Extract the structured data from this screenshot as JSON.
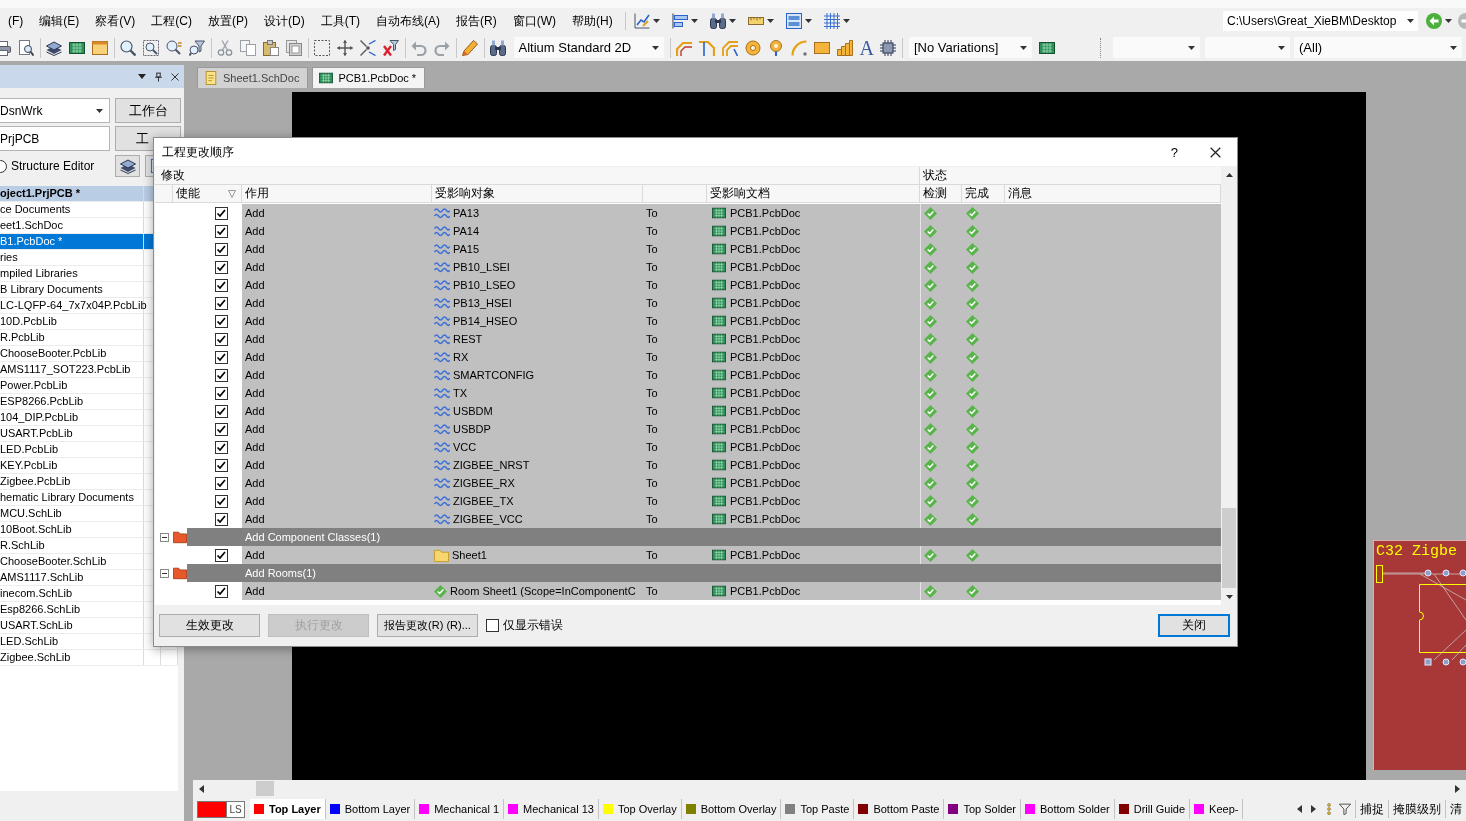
{
  "menu_bar": {
    "items": [
      "(F)",
      "编辑(E)",
      "察看(V)",
      "工程(C)",
      "放置(P)",
      "设计(D)",
      "工具(T)",
      "自动布线(A)",
      "报告(R)",
      "窗口(W)",
      "帮助(H)"
    ],
    "path": "C:\\Users\\Great_XieBM\\Desktop"
  },
  "toolbar": {
    "view_config": "Altium Standard 2D",
    "string_tool": "A",
    "variations": "[No Variations]",
    "scope": "(All)"
  },
  "projects_panel": {
    "workspace": "DsnWrk",
    "workspace_button": "工作台",
    "project": "PrjPCB",
    "project_button": "工",
    "structure_editor": {
      "label": "Structure Editor",
      "selected": false
    },
    "project_item": "oject1.PrjPCB *",
    "items": [
      {
        "label": "ce Documents",
        "selected": false
      },
      {
        "label": "eet1.SchDoc",
        "selected": false
      },
      {
        "label": "B1.PcbDoc *",
        "selected": true
      },
      {
        "label": "ries",
        "selected": false
      },
      {
        "label": "mpiled Libraries",
        "selected": false
      },
      {
        "label": "B Library Documents",
        "selected": false
      },
      {
        "label": "LC-LQFP-64_7x7x04P.PcbLib",
        "selected": false
      },
      {
        "label": "10D.PcbLib",
        "selected": false
      },
      {
        "label": "R.PcbLib",
        "selected": false
      },
      {
        "label": "ChooseBooter.PcbLib",
        "selected": false
      },
      {
        "label": "AMS1117_SOT223.PcbLib",
        "selected": false
      },
      {
        "label": "Power.PcbLib",
        "selected": false
      },
      {
        "label": "ESP8266.PcbLib",
        "selected": false
      },
      {
        "label": "104_DIP.PcbLib",
        "selected": false
      },
      {
        "label": "USART.PcbLib",
        "selected": false
      },
      {
        "label": "LED.PcbLib",
        "selected": false
      },
      {
        "label": "KEY.PcbLib",
        "selected": false
      },
      {
        "label": "Zigbee.PcbLib",
        "selected": false
      },
      {
        "label": "hematic Library Documents",
        "selected": false
      },
      {
        "label": "MCU.SchLib",
        "selected": false
      },
      {
        "label": "10Boot.SchLib",
        "selected": false
      },
      {
        "label": "R.SchLib",
        "selected": false
      },
      {
        "label": "ChooseBooter.SchLib",
        "selected": false
      },
      {
        "label": "AMS1117.SchLib",
        "selected": false
      },
      {
        "label": "inecom.SchLib",
        "selected": false
      },
      {
        "label": "Esp8266.SchLib",
        "selected": false
      },
      {
        "label": "USART.SchLib",
        "selected": false
      },
      {
        "label": "LED.SchLib",
        "selected": false
      },
      {
        "label": "Zigbee.SchLib",
        "selected": false
      }
    ]
  },
  "document_tabs": [
    {
      "label": "Sheet1.SchDoc",
      "kind": "schematic",
      "selected": false
    },
    {
      "label": "PCB1.PcbDoc *",
      "kind": "pcb",
      "selected": true
    }
  ],
  "board": {
    "label": "C32 Zigbe"
  },
  "dialog": {
    "title": "工程更改顺序",
    "help": "?",
    "column_groups": {
      "modify": "修改",
      "status": "状态"
    },
    "columns": {
      "enable": "使能",
      "action": "作用",
      "object": "受影响对象",
      "document": "受影响文档",
      "check": "检测",
      "done": "完成",
      "message": "消息"
    },
    "rows": [
      {
        "kind": "change",
        "enabled": true,
        "action": "Add",
        "object": {
          "kind": "net",
          "name": "PA13"
        },
        "to": "To",
        "document": "PCB1.PcbDoc",
        "check_passed": true,
        "completed": true
      },
      {
        "kind": "change",
        "enabled": true,
        "action": "Add",
        "object": {
          "kind": "net",
          "name": "PA14"
        },
        "to": "To",
        "document": "PCB1.PcbDoc",
        "check_passed": true,
        "completed": true
      },
      {
        "kind": "change",
        "enabled": true,
        "action": "Add",
        "object": {
          "kind": "net",
          "name": "PA15"
        },
        "to": "To",
        "document": "PCB1.PcbDoc",
        "check_passed": true,
        "completed": true
      },
      {
        "kind": "change",
        "enabled": true,
        "action": "Add",
        "object": {
          "kind": "net",
          "name": "PB10_LSEI"
        },
        "to": "To",
        "document": "PCB1.PcbDoc",
        "check_passed": true,
        "completed": true
      },
      {
        "kind": "change",
        "enabled": true,
        "action": "Add",
        "object": {
          "kind": "net",
          "name": "PB10_LSEO"
        },
        "to": "To",
        "document": "PCB1.PcbDoc",
        "check_passed": true,
        "completed": true
      },
      {
        "kind": "change",
        "enabled": true,
        "action": "Add",
        "object": {
          "kind": "net",
          "name": "PB13_HSEI"
        },
        "to": "To",
        "document": "PCB1.PcbDoc",
        "check_passed": true,
        "completed": true
      },
      {
        "kind": "change",
        "enabled": true,
        "action": "Add",
        "object": {
          "kind": "net",
          "name": "PB14_HSEO"
        },
        "to": "To",
        "document": "PCB1.PcbDoc",
        "check_passed": true,
        "completed": true
      },
      {
        "kind": "change",
        "enabled": true,
        "action": "Add",
        "object": {
          "kind": "net",
          "name": "REST"
        },
        "to": "To",
        "document": "PCB1.PcbDoc",
        "check_passed": true,
        "completed": true
      },
      {
        "kind": "change",
        "enabled": true,
        "action": "Add",
        "object": {
          "kind": "net",
          "name": "RX"
        },
        "to": "To",
        "document": "PCB1.PcbDoc",
        "check_passed": true,
        "completed": true
      },
      {
        "kind": "change",
        "enabled": true,
        "action": "Add",
        "object": {
          "kind": "net",
          "name": "SMARTCONFIG"
        },
        "to": "To",
        "document": "PCB1.PcbDoc",
        "check_passed": true,
        "completed": true
      },
      {
        "kind": "change",
        "enabled": true,
        "action": "Add",
        "object": {
          "kind": "net",
          "name": "TX"
        },
        "to": "To",
        "document": "PCB1.PcbDoc",
        "check_passed": true,
        "completed": true
      },
      {
        "kind": "change",
        "enabled": true,
        "action": "Add",
        "object": {
          "kind": "net",
          "name": "USBDM"
        },
        "to": "To",
        "document": "PCB1.PcbDoc",
        "check_passed": true,
        "completed": true
      },
      {
        "kind": "change",
        "enabled": true,
        "action": "Add",
        "object": {
          "kind": "net",
          "name": "USBDP"
        },
        "to": "To",
        "document": "PCB1.PcbDoc",
        "check_passed": true,
        "completed": true
      },
      {
        "kind": "change",
        "enabled": true,
        "action": "Add",
        "object": {
          "kind": "net",
          "name": "VCC"
        },
        "to": "To",
        "document": "PCB1.PcbDoc",
        "check_passed": true,
        "completed": true
      },
      {
        "kind": "change",
        "enabled": true,
        "action": "Add",
        "object": {
          "kind": "net",
          "name": "ZIGBEE_NRST"
        },
        "to": "To",
        "document": "PCB1.PcbDoc",
        "check_passed": true,
        "completed": true
      },
      {
        "kind": "change",
        "enabled": true,
        "action": "Add",
        "object": {
          "kind": "net",
          "name": "ZIGBEE_RX"
        },
        "to": "To",
        "document": "PCB1.PcbDoc",
        "check_passed": true,
        "completed": true
      },
      {
        "kind": "change",
        "enabled": true,
        "action": "Add",
        "object": {
          "kind": "net",
          "name": "ZIGBEE_TX"
        },
        "to": "To",
        "document": "PCB1.PcbDoc",
        "check_passed": true,
        "completed": true
      },
      {
        "kind": "change",
        "enabled": true,
        "action": "Add",
        "object": {
          "kind": "net",
          "name": "ZIGBEE_VCC"
        },
        "to": "To",
        "document": "PCB1.PcbDoc",
        "check_passed": true,
        "completed": true
      },
      {
        "kind": "group",
        "expanded": true,
        "label": "Add Component Classes(1)"
      },
      {
        "kind": "change",
        "enabled": true,
        "action": "Add",
        "object": {
          "kind": "class",
          "name": "Sheet1"
        },
        "to": "To",
        "document": "PCB1.PcbDoc",
        "check_passed": true,
        "completed": true
      },
      {
        "kind": "group",
        "expanded": true,
        "label": "Add Rooms(1)"
      },
      {
        "kind": "change",
        "enabled": true,
        "action": "Add",
        "object": {
          "kind": "room",
          "name": "Room Sheet1 (Scope=InComponentC"
        },
        "to": "To",
        "document": "PCB1.PcbDoc",
        "check_passed": true,
        "completed": true
      }
    ],
    "buttons": {
      "validate": "生效更改",
      "execute": {
        "label": "执行更改",
        "disabled": true
      },
      "report": "报告更改(R) (R)...",
      "close": "关闭"
    },
    "only_errors": {
      "label": "仅显示错误",
      "checked": false
    }
  },
  "layer_bar": {
    "current": {
      "label": "LS",
      "color": "#ff0000"
    },
    "layers": [
      {
        "label": "Top Layer",
        "color": "#ff0000",
        "selected": true
      },
      {
        "label": "Bottom Layer",
        "color": "#0000ff",
        "selected": false
      },
      {
        "label": "Mechanical 1",
        "color": "#ff00ff",
        "selected": false
      },
      {
        "label": "Mechanical 13",
        "color": "#ff00ff",
        "selected": false
      },
      {
        "label": "Top Overlay",
        "color": "#ffff00",
        "selected": false
      },
      {
        "label": "Bottom Overlay",
        "color": "#808000",
        "selected": false
      },
      {
        "label": "Top Paste",
        "color": "#808080",
        "selected": false
      },
      {
        "label": "Bottom Paste",
        "color": "#800000",
        "selected": false
      },
      {
        "label": "Top Solder",
        "color": "#800080",
        "selected": false
      },
      {
        "label": "Bottom Solder",
        "color": "#ff00ff",
        "selected": false
      },
      {
        "label": "Drill Guide",
        "color": "#800000",
        "selected": false
      },
      {
        "label": "Keep-",
        "color": "#ff00ff",
        "selected": false
      }
    ],
    "buttons": [
      "捕捉",
      "掩膜级别",
      "清"
    ]
  }
}
